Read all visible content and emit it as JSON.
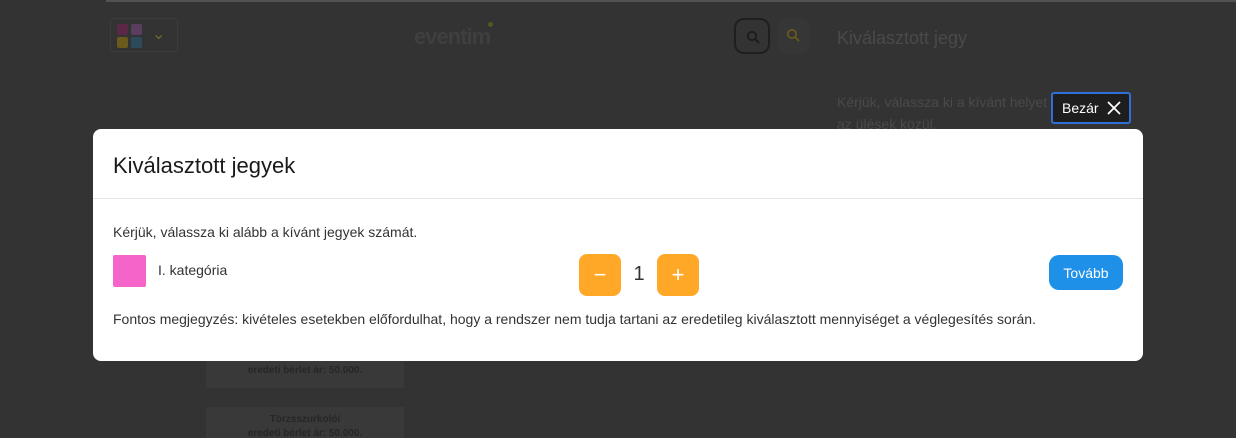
{
  "background": {
    "logo": "eventim",
    "sidebar_title": "Kiválasztott jegy",
    "sidebar_text": "Kérjük, válassza ki a kívánt helyet az ülések közül.",
    "card1_text": "eredeti bérlet ár: 50.000.",
    "card2_line1": "Törzsszurkolói",
    "card2_line2": "eredeti bérlet ár: 50.000."
  },
  "close_button": {
    "label": "Bezár",
    "icon": "close-icon"
  },
  "modal": {
    "title": "Kiválasztott jegyek",
    "instruction": "Kérjük, válassza ki alább a kívánt jegyek számát.",
    "category": {
      "label": "I. kategória",
      "color": "#f564c8"
    },
    "stepper": {
      "quantity": "1",
      "minus_symbol": "−",
      "plus_symbol": "+"
    },
    "next_label": "Tovább",
    "note": "Fontos megjegyzés: kivételes esetekben előfordulhat, hogy a rendszer nem tudja tartani az eredetileg kiválasztott mennyiséget a véglegesítés során."
  },
  "colors": {
    "accent_orange": "#ffa726",
    "accent_blue": "#1e90e8",
    "focus_outline": "#2f6fd6"
  }
}
